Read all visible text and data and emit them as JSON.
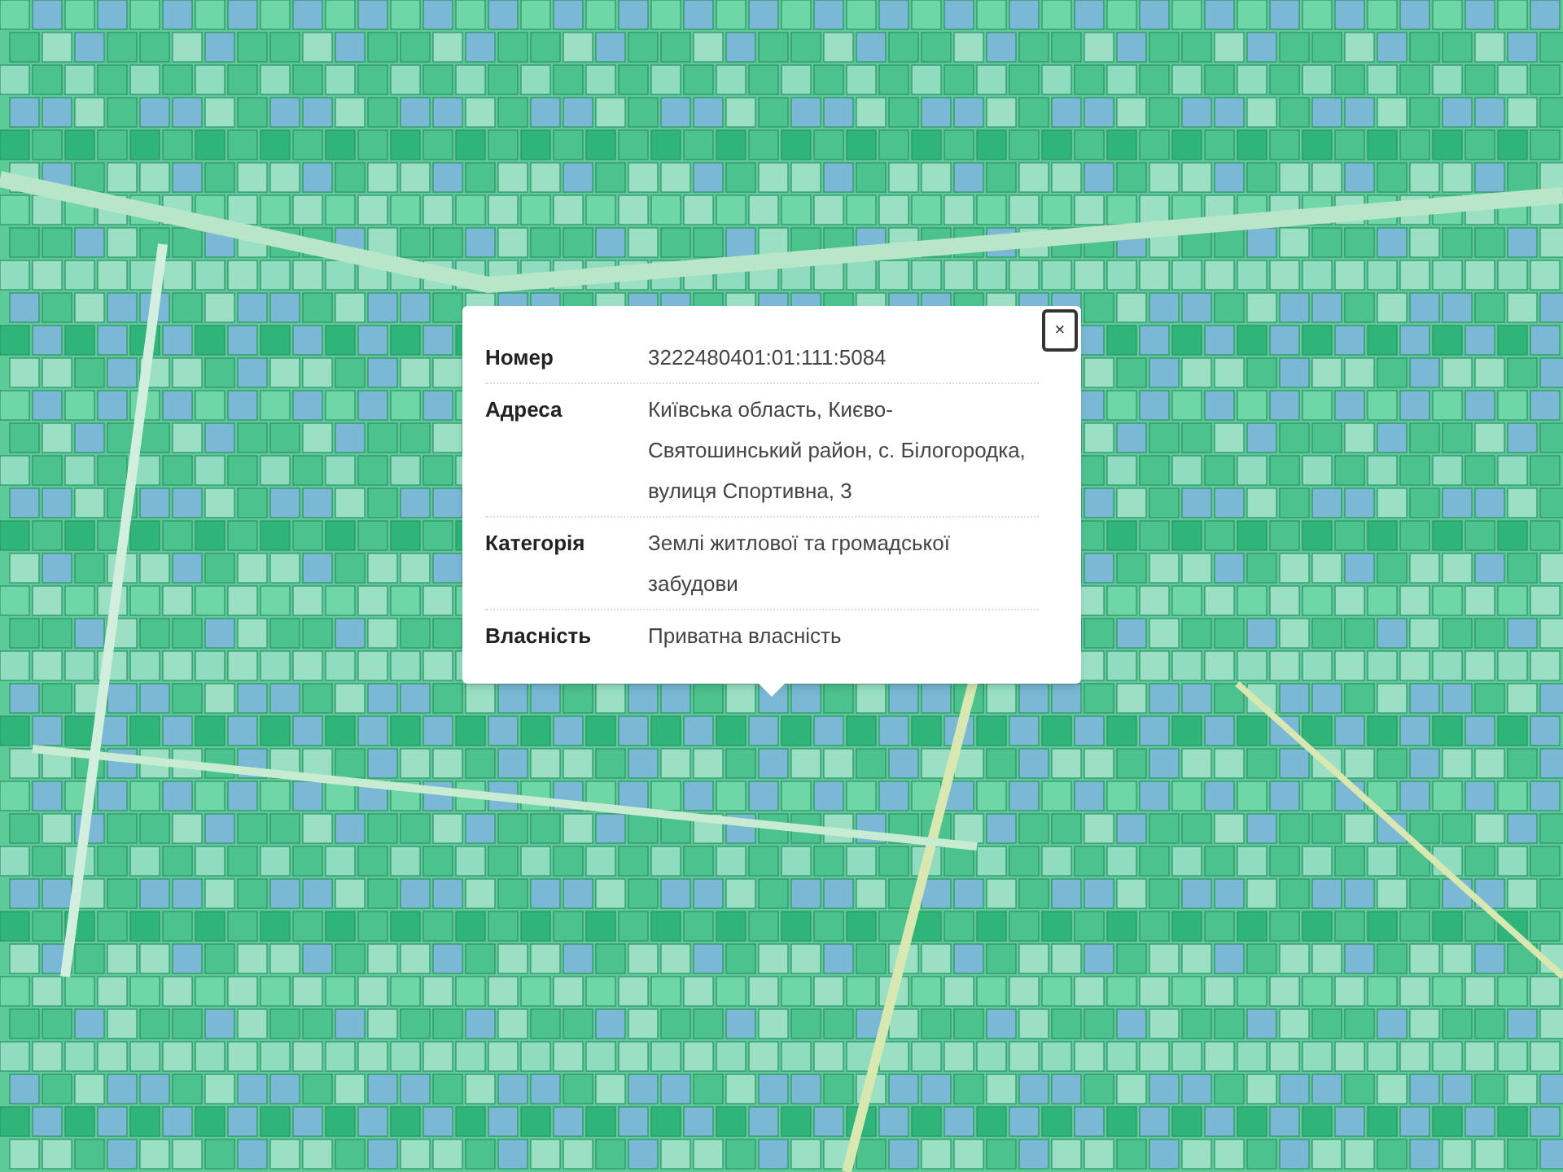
{
  "popup": {
    "close": "×",
    "rows": [
      {
        "label": "Номер",
        "value": "3222480401:01:111:5084"
      },
      {
        "label": "Адреса",
        "value": "Київська область, Києво-Святошинський район, с. Білогородка, вулиця Спортивна, 3"
      },
      {
        "label": "Категорія",
        "value": "Землі житлової та громадської забудови"
      },
      {
        "label": "Власність",
        "value": "Приватна власність"
      }
    ]
  }
}
